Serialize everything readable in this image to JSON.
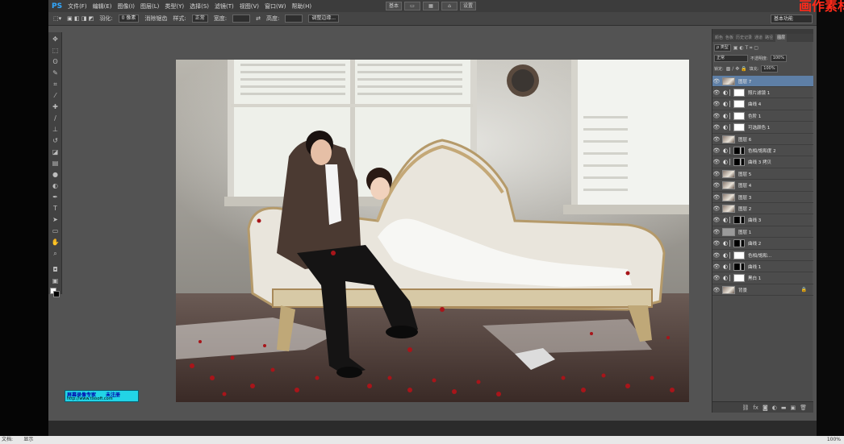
{
  "app": {
    "logo": "PS",
    "menus": [
      "文件(F)",
      "编辑(E)",
      "图像(I)",
      "图层(L)",
      "类型(Y)",
      "选择(S)",
      "滤镜(T)",
      "视图(V)",
      "窗口(W)",
      "帮助(H)"
    ],
    "top_buttons": [
      "基本",
      "",
      "",
      "",
      "设置"
    ],
    "corner_text": "画作素材淘宝"
  },
  "options": {
    "feather_label": "羽化:",
    "feather_value": "0 像素",
    "antialias": "消除锯齿",
    "style_label": "样式:",
    "style_value": "正常",
    "width_label": "宽度:",
    "height_label": "高度:",
    "refine_edge": "调整边缘...",
    "workspace": "基本功能"
  },
  "layers_panel": {
    "tabs": [
      "颜色",
      "色板",
      "历史记录",
      "通道",
      "路径",
      "图层"
    ],
    "active_tab": "图层",
    "filter": "ρ 类型",
    "blend_mode": "正常",
    "opacity_label": "不透明度:",
    "opacity_value": "100%",
    "lock_label": "锁定:",
    "fill_label": "填充:",
    "fill_value": "100%",
    "layers": [
      {
        "name": "图层 7",
        "thumb": "photo-t",
        "selected": true
      },
      {
        "name": "照片滤镜 1",
        "thumb": "adj",
        "mask": "white"
      },
      {
        "name": "曲线 4",
        "thumb": "adj",
        "mask": "white"
      },
      {
        "name": "色阶 1",
        "thumb": "adj",
        "mask": "white"
      },
      {
        "name": "可选颜色 1",
        "thumb": "adj",
        "mask": "white"
      },
      {
        "name": "图层 6",
        "thumb": "photo-t"
      },
      {
        "name": "色相/饱和度 2",
        "thumb": "adj",
        "mask": "dark"
      },
      {
        "name": "曲线 3 拷贝",
        "thumb": "adj",
        "mask": "dark"
      },
      {
        "name": "图层 5",
        "thumb": "photo-t"
      },
      {
        "name": "图层 4",
        "thumb": "photo-t"
      },
      {
        "name": "图层 3",
        "thumb": "photo-t"
      },
      {
        "name": "图层 2",
        "thumb": "photo-t"
      },
      {
        "name": "曲线 3",
        "thumb": "adj",
        "mask": "dark"
      },
      {
        "name": "图层 1",
        "thumb": "grey-t"
      },
      {
        "name": "曲线 2",
        "thumb": "adj",
        "mask": "dark"
      },
      {
        "name": "色相/饱和...",
        "thumb": "adj",
        "mask": "white"
      },
      {
        "name": "曲线 1",
        "thumb": "adj",
        "mask": "dark"
      },
      {
        "name": "黑白 1",
        "thumb": "adj",
        "mask": "white"
      },
      {
        "name": "背景",
        "thumb": "photo-t",
        "locked": true
      }
    ]
  },
  "watermark": {
    "line1": "屏幕录像专家　　未注册",
    "line2": "http://www.tlxsoft.com"
  },
  "status": {
    "left": "文档:          显示",
    "right": "100%"
  }
}
